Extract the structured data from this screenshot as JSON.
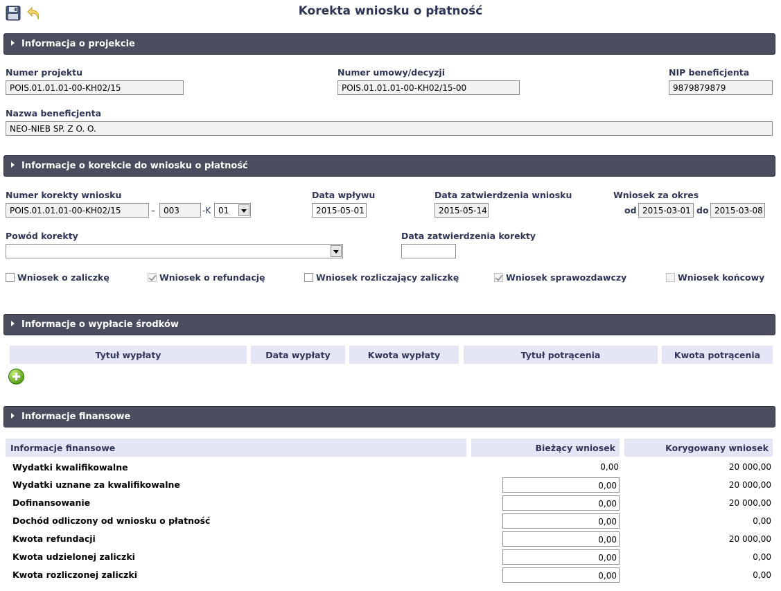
{
  "page": {
    "title": "Korekta wniosku o płatność"
  },
  "toolbar": {
    "save_icon": "floppy-disk-icon",
    "undo_icon": "undo-arrow-icon"
  },
  "sections": {
    "project": "Informacja o projekcie",
    "correction": "Informacje o korekcie do wniosku o płatność",
    "payout": "Informacje o wypłacie środków",
    "finance": "Informacje finansowe"
  },
  "project": {
    "numer_projektu_label": "Numer projektu",
    "numer_projektu": "POIS.01.01.01-00-KH02/15",
    "numer_umowy_label": "Numer umowy/decyzji",
    "numer_umowy": "POIS.01.01.01-00-KH02/15-00",
    "nip_label": "NIP beneficjenta",
    "nip": "9879879879",
    "nazwa_label": "Nazwa beneficjenta",
    "nazwa": "NEO-NIEB SP. Z O. O."
  },
  "correction": {
    "numer_korekty_label": "Numer korekty wniosku",
    "numer_korekty": "POIS.01.01.01-00-KH02/15",
    "dash": "–",
    "numer_czesc": "003",
    "k_prefix": "-K",
    "k_value": "01",
    "data_wplywu_label": "Data wpływu",
    "data_wplywu": "2015-05-01",
    "data_zatw_wniosku_label": "Data zatwierdzenia wniosku",
    "data_zatw_wniosku": "2015-05-14",
    "okres_label": "Wniosek za okres",
    "od_label": "od",
    "okres_od": "2015-03-01",
    "do_label": "do",
    "okres_do": "2015-03-08",
    "powod_label": "Powód korekty",
    "powod": "",
    "data_zatw_korekty_label": "Data zatwierdzenia korekty",
    "data_zatw_korekty": "",
    "checkboxes": [
      {
        "label": "Wniosek o zaliczkę",
        "checked": false,
        "disabled": false
      },
      {
        "label": "Wniosek o refundację",
        "checked": true,
        "disabled": true
      },
      {
        "label": "Wniosek rozliczający zaliczkę",
        "checked": false,
        "disabled": false
      },
      {
        "label": "Wniosek sprawozdawczy",
        "checked": true,
        "disabled": true
      },
      {
        "label": "Wniosek końcowy",
        "checked": false,
        "disabled": true
      }
    ]
  },
  "payout": {
    "columns": [
      "Tytuł wypłaty",
      "Data wypłaty",
      "Kwota wypłaty",
      "Tytuł potrącenia",
      "Kwota potrącenia"
    ],
    "add_icon": "add-plus-icon"
  },
  "finance": {
    "columns": [
      "Informacje finansowe",
      "Bieżący wniosek",
      "Korygowany wniosek"
    ],
    "rows": [
      {
        "label": "Wydatki kwalifikowalne",
        "current": "0,00",
        "corrected": "20 000,00",
        "editable": false
      },
      {
        "label": "Wydatki uznane za kwalifikowalne",
        "current": "0,00",
        "corrected": "20 000,00",
        "editable": true
      },
      {
        "label": "Dofinansowanie",
        "current": "0,00",
        "corrected": "20 000,00",
        "editable": true
      },
      {
        "label": "Dochód odliczony od wniosku o płatność",
        "current": "0,00",
        "corrected": "0,00",
        "editable": true
      },
      {
        "label": "Kwota refundacji",
        "current": "0,00",
        "corrected": "20 000,00",
        "editable": true
      },
      {
        "label": "Kwota udzielonej zaliczki",
        "current": "0,00",
        "corrected": "0,00",
        "editable": true
      },
      {
        "label": "Kwota rozliczonej zaliczki",
        "current": "0,00",
        "corrected": "0,00",
        "editable": true
      }
    ]
  }
}
